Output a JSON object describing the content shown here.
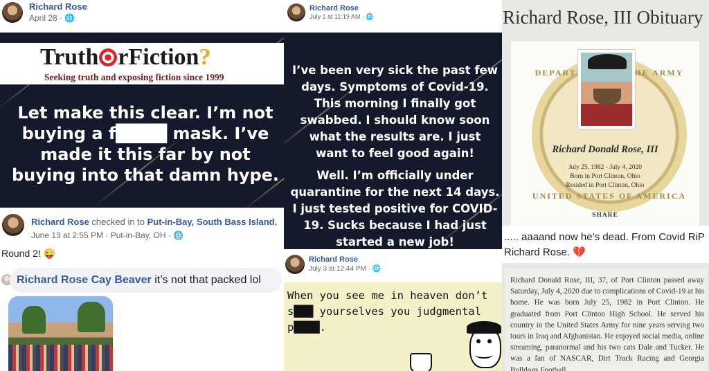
{
  "panel1": {
    "name": "Richard Rose",
    "date": "April 28 · ",
    "logo_left": "Truth",
    "logo_mid": "rFiction",
    "logo_q": "?",
    "tagline": "Seeking truth and exposing fiction since 1999",
    "post_text": "Let make this clear. I’m not buying a f████ mask. I’ve made it this far by not buying into that damn hype."
  },
  "panel2": {
    "name": "Richard Rose",
    "date": "July 1 at 11:19 AM · ",
    "para1": "I’ve been very sick the past few days. Symptoms of Covid-19. This morning I finally got swabbed. I should know soon what the results are. I just want to feel good again!",
    "para2": "Well. I’m officially under quarantine for the next 14 days. I just tested positive for COVID-19. Sucks because I had just started a new job!"
  },
  "panel3": {
    "name": "Richard Rose",
    "checked_in": " checked in to ",
    "place": "Put-in-Bay, South Bass Island.",
    "date": "June 13 at 2:55 PM · Put-in-Bay, OH · ",
    "status": "Round 2! 😜",
    "comment_name": "Richard Rose",
    "comment_tag": "Cay Beaver",
    "comment_text": " it’s not that packed lol"
  },
  "panel4": {
    "name": "Richard Rose",
    "date": "July 3 at 12:44 PM · ",
    "meme_text": "When you see me in heaven don’t s███ yourselves you judgmental p████."
  },
  "panel5": {
    "header": "Richard Rose, III Obituary",
    "seal_top": "DEPARTMENT OF THE ARMY",
    "seal_bottom": "UNITED STATES OF AMERICA",
    "full_name": "Richard Donald Rose, III",
    "dates": "July 25, 1982 - July 4, 2020",
    "born": "Born in Port Clinton, Ohio",
    "resided": "Resided in Port Clinton, Ohio",
    "share": "SHARE",
    "caption": "..... aaaand now he’s dead. From Covid RiP Richard Rose. 💔",
    "body": "Richard Donald Rose, III, 37, of Port Clinton passed away Saturday, July 4, 2020 due to complications of Covid-19 at his home. He was born July 25, 1982 in Port Clinton. He graduated from Port Clinton High School. He served his country in the United States Army for nine years serving two tours in Iraq and Afghanistan. He enjoyed social media, online streaming, paranormal and his two cats Dale and Tucker. He was a fan of NASCAR, Dirt Track Racing and Georgia Bulldogs Football."
  }
}
